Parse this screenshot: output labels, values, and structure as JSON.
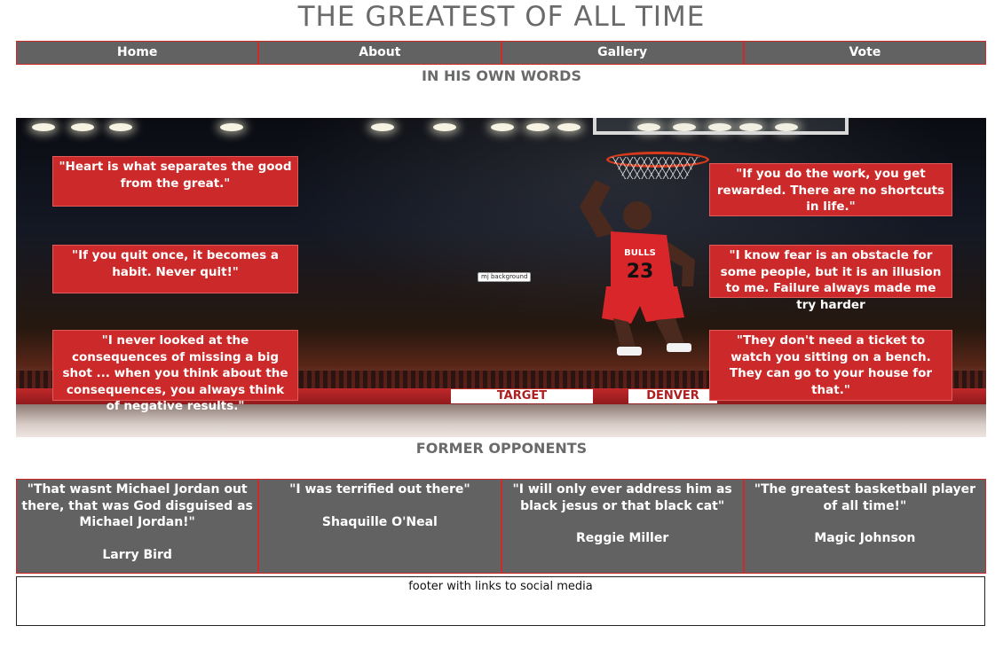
{
  "page": {
    "title": "THE GREATEST OF ALL TIME"
  },
  "nav": {
    "items": [
      "Home",
      "About",
      "Gallery",
      "Vote"
    ]
  },
  "sections": {
    "quotes_heading": "IN HIS OWN WORDS",
    "opponents_heading": "FORMER OPPONENTS"
  },
  "hero": {
    "image_alt": "mj background",
    "jersey_team": "BULLS",
    "jersey_number": "23",
    "sign": "TARGET",
    "sign2": "DENVER"
  },
  "quotes": [
    "\"Heart is what separates the good from the great.\"",
    "\"If you quit once, it becomes a habit. Never quit!\"",
    "\"I never looked at the consequences of missing a big shot ... when you think about the consequences, you always think of negative results.\"",
    "\"If you do the work, you get rewarded. There are no shortcuts in life.\"",
    "\"I know fear is an obstacle for some people, but it is an illusion to me. Failure always made me try harder",
    "\"They don't need a ticket to watch you sitting on a bench. They can go to your house for that.\""
  ],
  "opponents": [
    {
      "quote": "\"That wasnt Michael Jordan out there, that was God disguised as Michael Jordan!\"",
      "name": "Larry Bird"
    },
    {
      "quote": "\"I was terrified out there\"",
      "name": "Shaquille O'Neal"
    },
    {
      "quote": "\"I will only ever address him as black jesus or that black cat\"",
      "name": "Reggie Miller"
    },
    {
      "quote": "\"The greatest basketball player of all time!\"",
      "name": "Magic Johnson"
    }
  ],
  "footer": {
    "text": "footer with links to social media"
  },
  "colors": {
    "accent_red": "#cc2a2a",
    "nav_gray": "#626262",
    "heading_gray": "#6a6a6a"
  }
}
